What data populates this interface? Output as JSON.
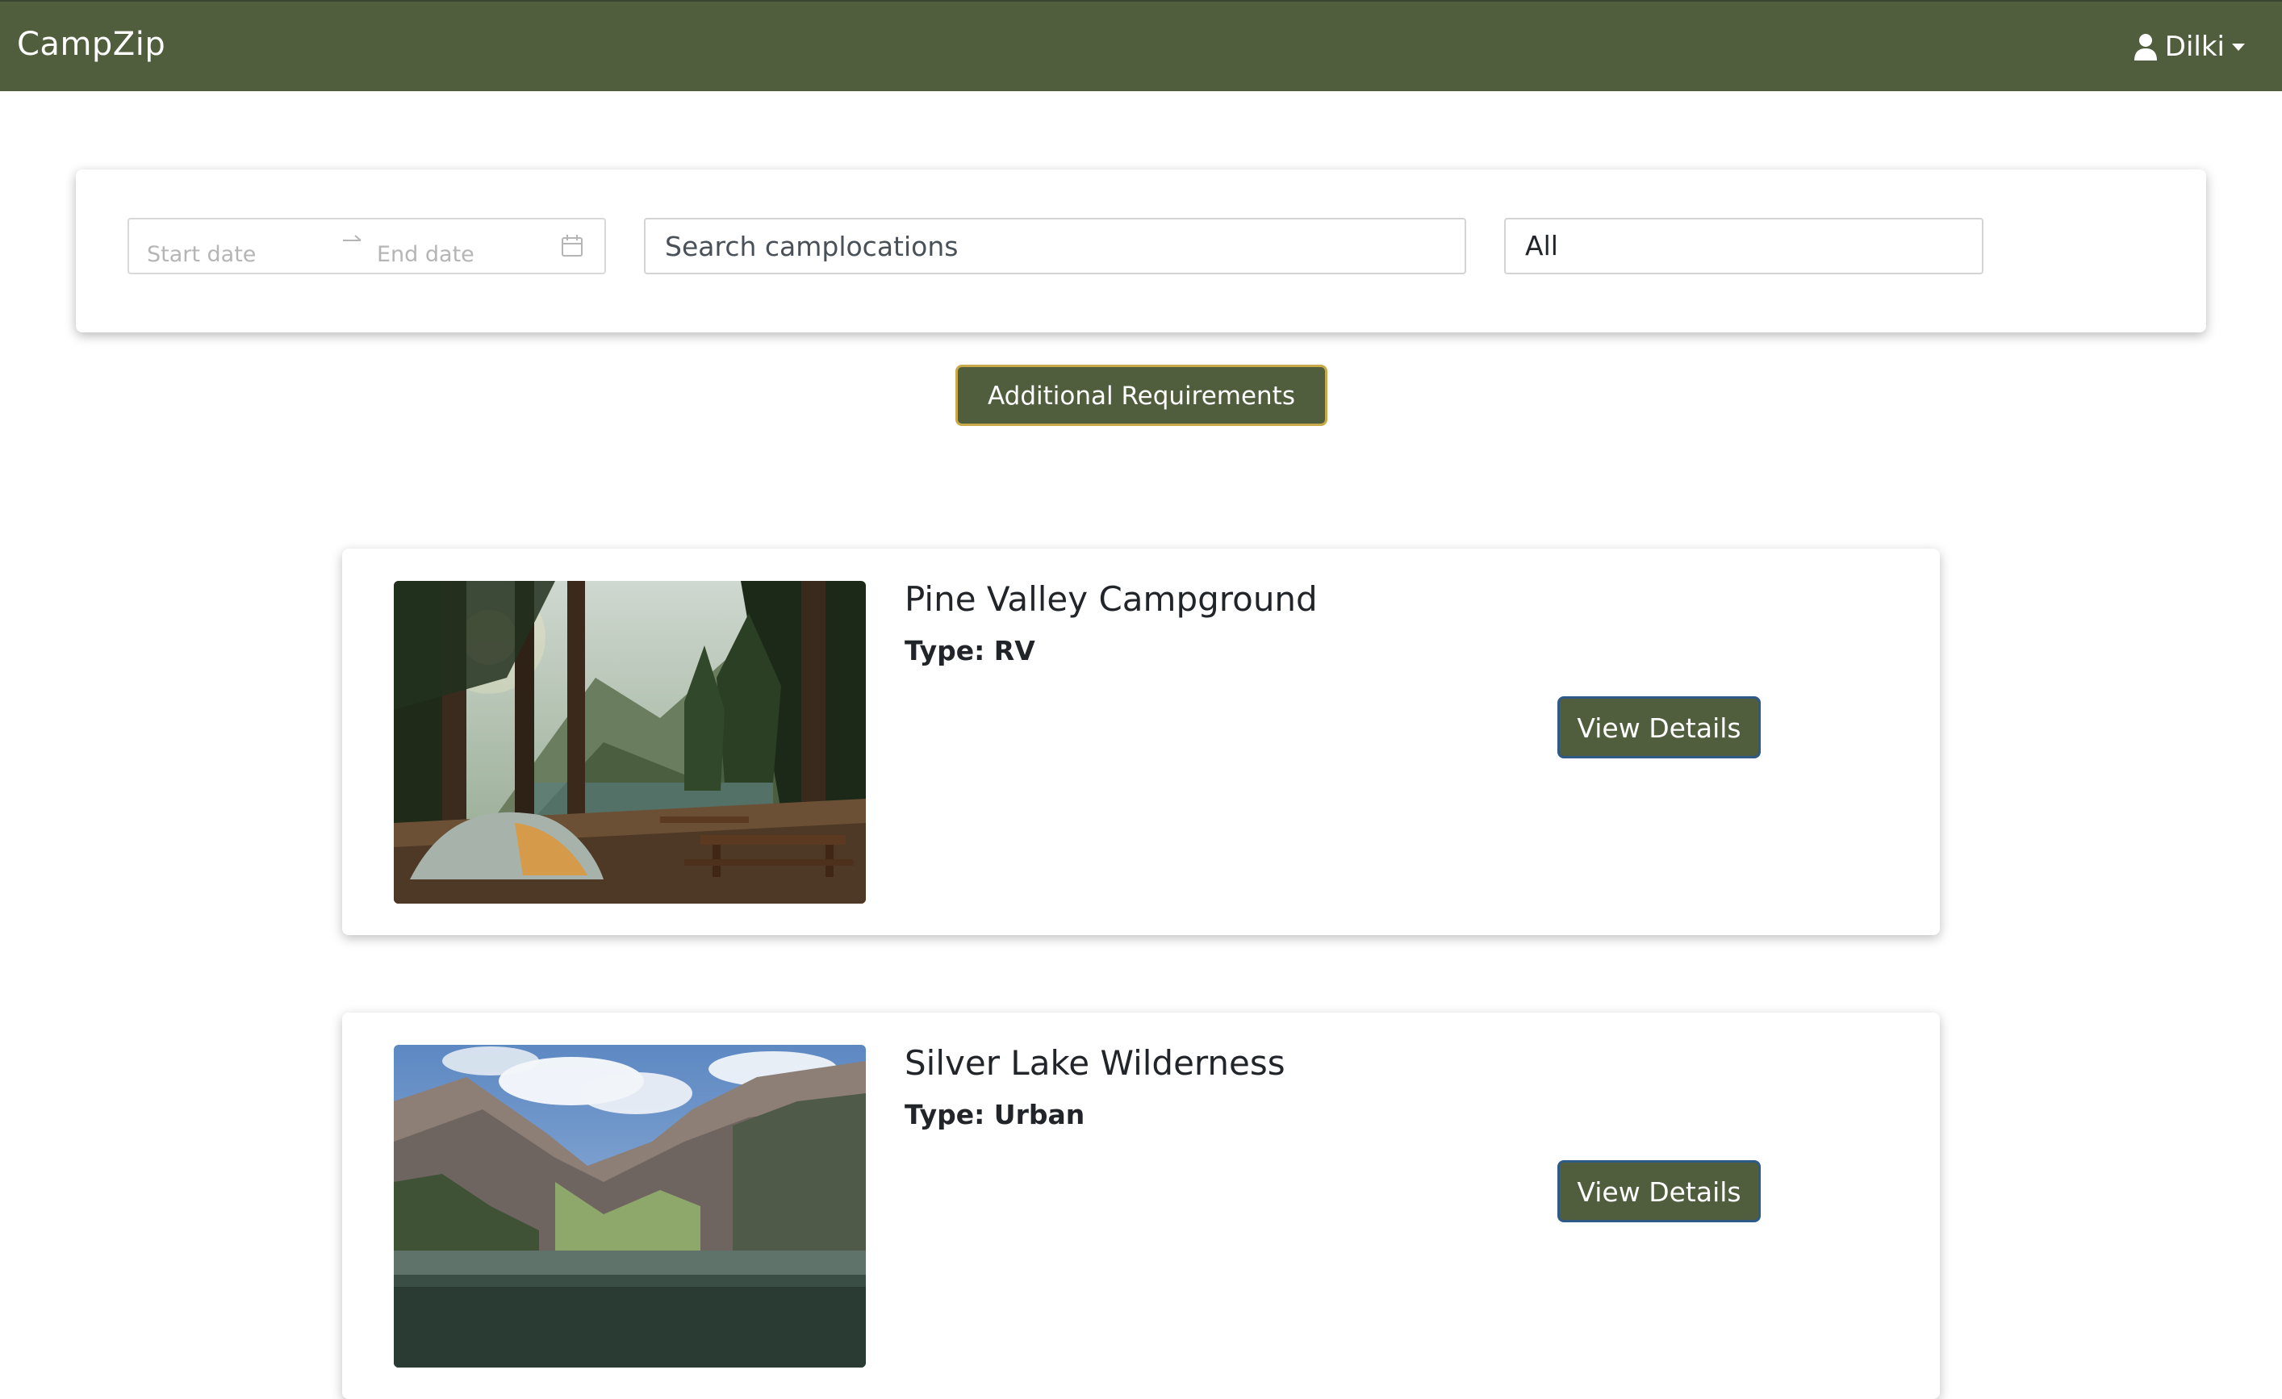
{
  "navbar": {
    "brand": "CampZip",
    "user_name": "Dilki",
    "icons": {
      "user": "user-icon",
      "caret": "caret-down-icon"
    }
  },
  "search": {
    "start_placeholder": "Start date",
    "end_placeholder": "End date",
    "location_placeholder": "Search camplocations",
    "type_selected": "All",
    "icons": {
      "arrow": "arrow-right-icon",
      "calendar": "calendar-icon"
    }
  },
  "filters": {
    "additional_label": "Additional Requirements"
  },
  "camps": [
    {
      "name": "Pine Valley Campground",
      "type": "Type: RV",
      "button": "View Details"
    },
    {
      "name": "Silver Lake Wilderness",
      "type": "Type: Urban",
      "button": "View Details"
    }
  ],
  "colors": {
    "primary": "#515e3e",
    "accent_border": "#c9a94a",
    "button_border": "#2f5a86",
    "background": "#ffffff"
  }
}
